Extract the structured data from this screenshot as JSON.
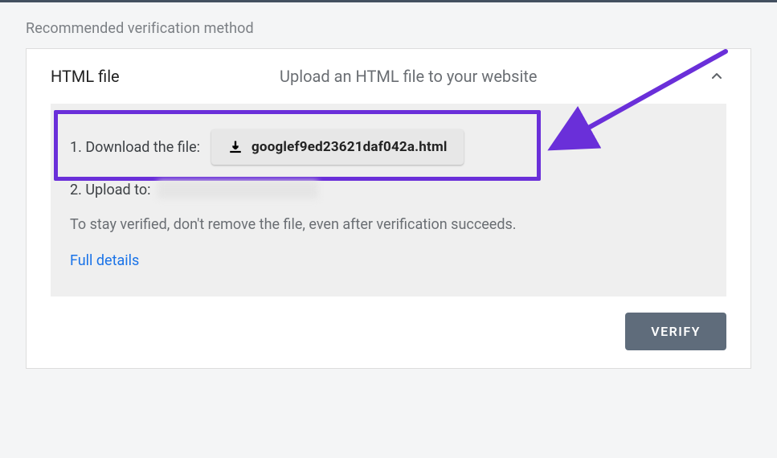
{
  "header": {
    "title": "Recommended verification method"
  },
  "card": {
    "title": "HTML file",
    "subtitle": "Upload an HTML file to your website"
  },
  "content": {
    "step1_label": "1. Download the file:",
    "download_filename": "googlef9ed23621daf042a.html",
    "step2_label": "2. Upload to:",
    "info_text": "To stay verified, don't remove the file, even after verification succeeds.",
    "link_text": "Full details"
  },
  "footer": {
    "verify_label": "VERIFY"
  },
  "colors": {
    "highlight": "#6a2fd9",
    "link": "#1a73e8",
    "verify_bg": "#5f6c7b"
  }
}
